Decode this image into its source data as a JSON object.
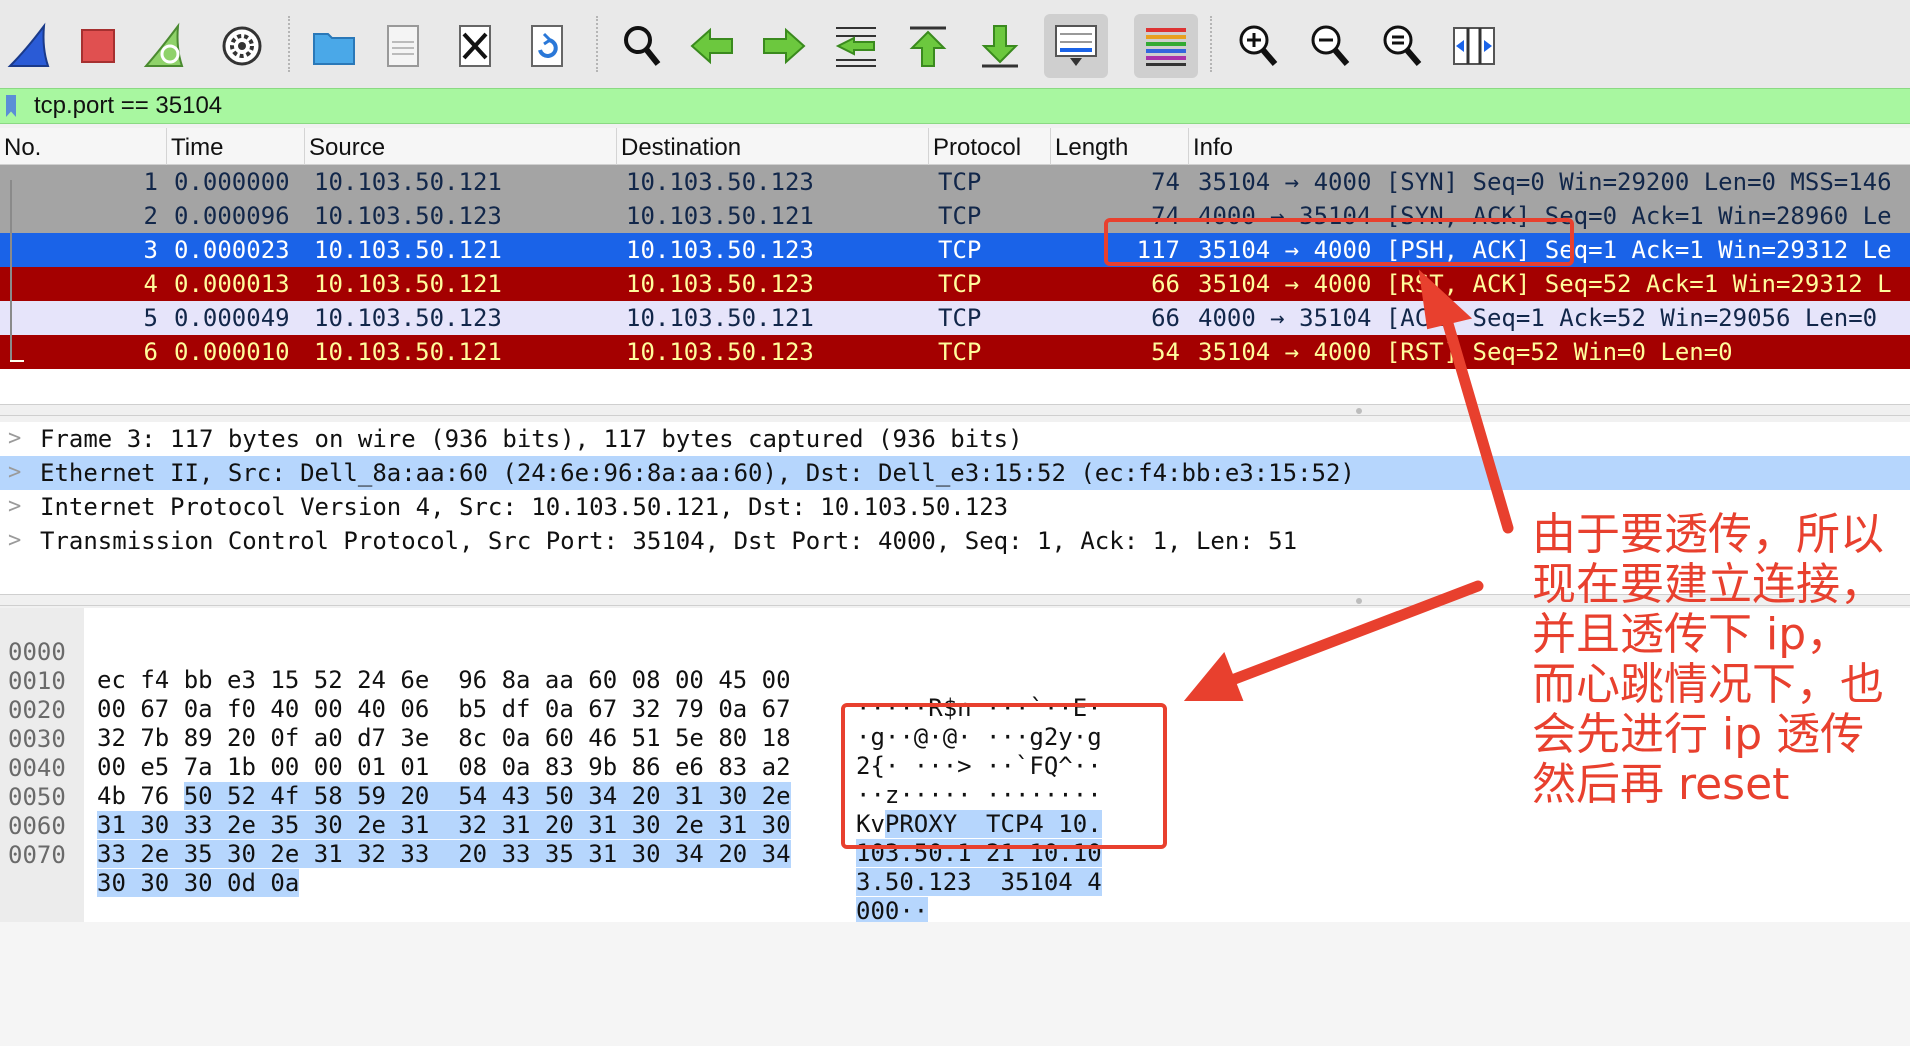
{
  "toolbar": {
    "icons": [
      "shark-fin-start-icon",
      "stop-capture-icon",
      "restart-capture-icon",
      "capture-options-icon",
      "open-file-icon",
      "save-file-icon",
      "close-file-icon",
      "reload-file-icon",
      "find-packet-icon",
      "go-back-icon",
      "go-forward-icon",
      "go-to-packet-icon",
      "first-packet-icon",
      "last-packet-icon",
      "autoscroll-icon",
      "colorize-icon",
      "zoom-in-icon",
      "zoom-out-icon",
      "zoom-normal-icon",
      "resize-columns-icon"
    ]
  },
  "filter": {
    "value": "tcp.port == 35104"
  },
  "packet_list": {
    "columns": [
      "No.",
      "Time",
      "Source",
      "Destination",
      "Protocol",
      "Length",
      "Info"
    ],
    "rows": [
      {
        "no": "1",
        "time": "0.000000",
        "source": "10.103.50.121",
        "destination": "10.103.50.123",
        "protocol": "TCP",
        "length": "74",
        "info": "35104 → 4000 [SYN] Seq=0 Win=29200 Len=0 MSS=146",
        "style": "gray"
      },
      {
        "no": "2",
        "time": "0.000096",
        "source": "10.103.50.123",
        "destination": "10.103.50.121",
        "protocol": "TCP",
        "length": "74",
        "info": "4000 → 35104 [SYN, ACK] Seq=0 Ack=1 Win=28960 Le",
        "style": "gray"
      },
      {
        "no": "3",
        "time": "0.000023",
        "source": "10.103.50.121",
        "destination": "10.103.50.123",
        "protocol": "TCP",
        "length": "117",
        "info": "35104 → 4000 [PSH, ACK] Seq=1 Ack=1 Win=29312 Le",
        "style": "blue"
      },
      {
        "no": "4",
        "time": "0.000013",
        "source": "10.103.50.121",
        "destination": "10.103.50.123",
        "protocol": "TCP",
        "length": "66",
        "info": "35104 → 4000 [RST, ACK] Seq=52 Ack=1 Win=29312 L",
        "style": "red"
      },
      {
        "no": "5",
        "time": "0.000049",
        "source": "10.103.50.123",
        "destination": "10.103.50.121",
        "protocol": "TCP",
        "length": "66",
        "info": "4000 → 35104 [ACK] Seq=1 Ack=52 Win=29056 Len=0",
        "style": "lav"
      },
      {
        "no": "6",
        "time": "0.000010",
        "source": "10.103.50.121",
        "destination": "10.103.50.123",
        "protocol": "TCP",
        "length": "54",
        "info": "35104 → 4000 [RST] Seq=52 Win=0 Len=0",
        "style": "red"
      }
    ]
  },
  "details": {
    "rows": [
      {
        "text": "Frame 3: 117 bytes on wire (936 bits), 117 bytes captured (936 bits)",
        "selected": false
      },
      {
        "text": "Ethernet II, Src: Dell_8a:aa:60 (24:6e:96:8a:aa:60), Dst: Dell_e3:15:52 (ec:f4:bb:e3:15:52)",
        "selected": true
      },
      {
        "text": "Internet Protocol Version 4, Src: 10.103.50.121, Dst: 10.103.50.123",
        "selected": false
      },
      {
        "text": "Transmission Control Protocol, Src Port: 35104, Dst Port: 4000, Seq: 1, Ack: 1, Len: 51",
        "selected": false
      }
    ]
  },
  "bytes": {
    "rows": [
      {
        "offset": "0000",
        "hex_plain": "ec f4 bb e3 15 52 24 6e  96 8a aa 60 08 00 45 00",
        "hex_hl": "",
        "ascii_plain": "·····R$n ···`··E·",
        "ascii_hl": ""
      },
      {
        "offset": "0010",
        "hex_plain": "00 67 0a f0 40 00 40 06  b5 df 0a 67 32 79 0a 67",
        "hex_hl": "",
        "ascii_plain": "·g··@·@· ···g2y·g",
        "ascii_hl": ""
      },
      {
        "offset": "0020",
        "hex_plain": "32 7b 89 20 0f a0 d7 3e  8c 0a 60 46 51 5e 80 18",
        "hex_hl": "",
        "ascii_plain": "2{· ···> ··`FQ^··",
        "ascii_hl": ""
      },
      {
        "offset": "0030",
        "hex_plain": "00 e5 7a 1b 00 00 01 01  08 0a 83 9b 86 e6 83 a2",
        "hex_hl": "",
        "ascii_plain": "··z····· ········",
        "ascii_hl": ""
      },
      {
        "offset": "0040",
        "hex_plain": "4b 76 ",
        "hex_hl": "50 52 4f 58 59 20  54 43 50 34 20 31 30 2e",
        "ascii_plain": "Kv",
        "ascii_hl": "PROXY  TCP4 10."
      },
      {
        "offset": "0050",
        "hex_plain": "",
        "hex_hl": "31 30 33 2e 35 30 2e 31  32 31 20 31 30 2e 31 30",
        "ascii_plain": "",
        "ascii_hl": "103.50.1 21 10.10"
      },
      {
        "offset": "0060",
        "hex_plain": "",
        "hex_hl": "33 2e 35 30 2e 31 32 33  20 33 35 31 30 34 20 34",
        "ascii_plain": "",
        "ascii_hl": "3.50.123  35104 4"
      },
      {
        "offset": "0070",
        "hex_plain": "",
        "hex_hl": "30 30 30 0d 0a",
        "ascii_plain": "",
        "ascii_hl": "000··"
      }
    ]
  },
  "annotation": {
    "lines": [
      "由于要透传，所以",
      "现在要建立连接，",
      "并且透传下 ip，",
      "而心跳情况下，也",
      "会先进行 ip 透传",
      "然后再 reset"
    ],
    "color": "#e8402e"
  },
  "colors": {
    "row_gray": "#a4a4a4",
    "row_blue": "#1a63e8",
    "row_red": "#a40000",
    "row_lavender": "#e6e4fa",
    "filter_bg": "#a8f7a0",
    "selection": "#b6d6fd"
  }
}
